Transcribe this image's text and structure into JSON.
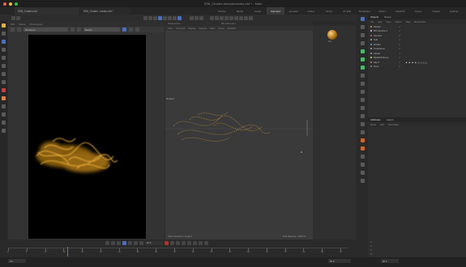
{
  "window": {
    "title": "SS8_Cluster-aerosat-hanks.c4d * - Main"
  },
  "tabs": {
    "doc1": "SS8_Cluster.c4d",
    "doc2": "SS8_Cluster...hanks.c4d *"
  },
  "layouts": [
    {
      "label": "Startup",
      "active": false
    },
    {
      "label": "Model",
      "active": false
    },
    {
      "label": "Sculpt",
      "active": false
    },
    {
      "label": "Standard",
      "active": true
    },
    {
      "label": "Animate",
      "active": false
    },
    {
      "label": "Nodes",
      "active": false
    },
    {
      "label": "Script",
      "active": false
    },
    {
      "label": "UV Edit",
      "active": false
    },
    {
      "label": "BodyPaint",
      "active": false
    },
    {
      "label": "Motion",
      "active": false
    },
    {
      "label": "Redshift",
      "active": false
    },
    {
      "label": "Vertex",
      "active": false
    },
    {
      "label": "Tracker",
      "active": false
    },
    {
      "label": "Lighting",
      "active": false
    }
  ],
  "left_viewport": {
    "head": [
      "IPR",
      "Pause",
      "Preferences"
    ],
    "dropdown1": "Rendered",
    "dropdown2": "Beauty",
    "status": "Frame 16 · 2560×1440 · 00:00:04 (30 fps)"
  },
  "main_viewport": {
    "header": "Perspective",
    "camera_name": "RS Camera 1",
    "menu": [
      "View",
      "Cameras",
      "Display",
      "Options",
      "Filter",
      "Panel",
      "Redshift"
    ],
    "cam_label": "Default",
    "footer": "View Transform: Project",
    "grid_spacing": "Grid Spacing : 1000 cm"
  },
  "materials": {
    "label": "Mat"
  },
  "objects": {
    "tabs": [
      "Objects",
      "Scene"
    ],
    "menu": [
      "File",
      "Edit",
      "View",
      "Object",
      "Tags",
      "Bookmarks"
    ],
    "rows": [
      {
        "name": "Cluster",
        "color": "#e0a030"
      },
      {
        "name": "RS Camera 1",
        "color": "#d0d0d0"
      },
      {
        "name": "Aerosat",
        "color": "#d06060"
      },
      {
        "name": "Null",
        "color": "#aaaaaa"
      },
      {
        "name": "Emitter",
        "color": "#60a0e0"
      },
      {
        "name": "Turbulence",
        "color": "#a0a0e0"
      },
      {
        "name": "Attract",
        "color": "#a0a0e0"
      },
      {
        "name": "Redshift Dome",
        "color": "#e0e060"
      },
      {
        "name": "Sky.2",
        "color": "#e07070"
      },
      {
        "name": "Floor",
        "color": "#70a070"
      }
    ],
    "tag_glyphs": "▲ ▲ ▲ ▲ △ △ △ △"
  },
  "attributes": {
    "tabs": [
      "Attributes",
      "Layers"
    ],
    "menu": [
      "Mode",
      "Edit",
      "User Data"
    ],
    "grid": [
      "0",
      "0",
      "0",
      "0 °"
    ]
  },
  "timeline": {
    "ticks": [
      "0",
      "5",
      "10",
      "15",
      "20",
      "25",
      "30",
      "35",
      "40",
      "45",
      "50",
      "55",
      "60",
      "65",
      "70",
      "75",
      "80",
      "85",
      "90"
    ],
    "playhead_frame": 16,
    "frame_current": "16 F",
    "frame_start": "0 F",
    "frame_end": "90 F",
    "field_right": "90 F"
  }
}
